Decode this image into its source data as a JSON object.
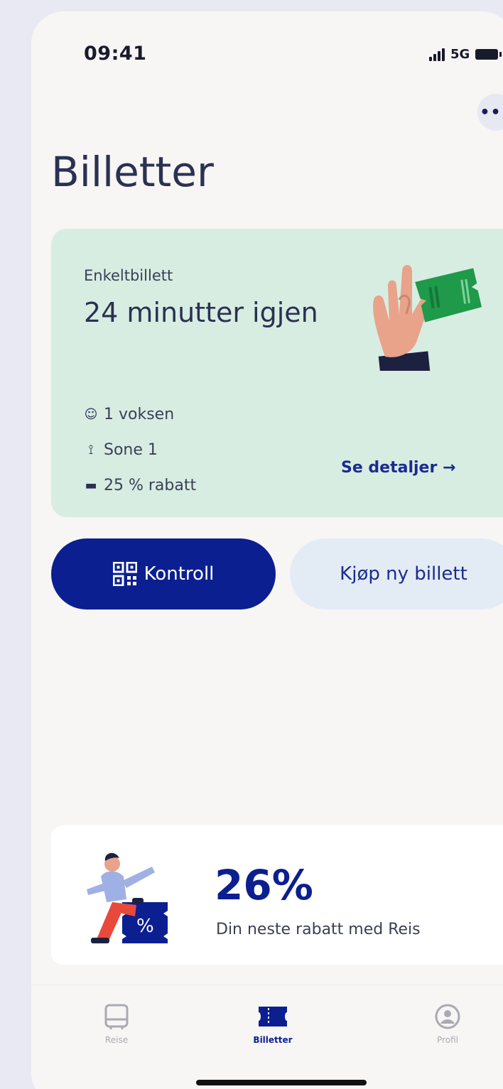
{
  "status_bar": {
    "time": "09:41",
    "network": "5G"
  },
  "header": {
    "more_icon": "ellipsis-icon",
    "more_label": "•••",
    "title": "Billetter"
  },
  "active_ticket": {
    "type": "Enkeltbillett",
    "time_remaining": "24 minutter igjen",
    "illustration": "hand-holding-ticket",
    "details": [
      {
        "icon": "person-icon",
        "glyph": "☺",
        "text": "1 voksen"
      },
      {
        "icon": "zone-icon",
        "glyph": "⟟",
        "text": "Sone 1"
      },
      {
        "icon": "ticket-icon",
        "glyph": "▬",
        "text": "25 % rabatt"
      }
    ],
    "see_details_label": "Se detaljer →"
  },
  "actions": {
    "control_label": "Kontroll",
    "buy_label": "Kjøp ny billett"
  },
  "discount_card": {
    "value": "26%",
    "label": "Din neste rabatt med Reis",
    "illustration": "person-stepping-on-ticket"
  },
  "tab_bar": {
    "tabs": [
      {
        "label": "Reise",
        "icon": "travel-icon",
        "active": false
      },
      {
        "label": "Billetter",
        "icon": "ticket-icon",
        "active": true
      },
      {
        "label": "Profil",
        "icon": "profile-icon",
        "active": false
      }
    ]
  },
  "colors": {
    "accent": "#0b1f91",
    "ticket_card_bg": "#d8ede2",
    "buy_button_bg": "#e3ecf5",
    "ticket_green": "#1e9a4a"
  }
}
